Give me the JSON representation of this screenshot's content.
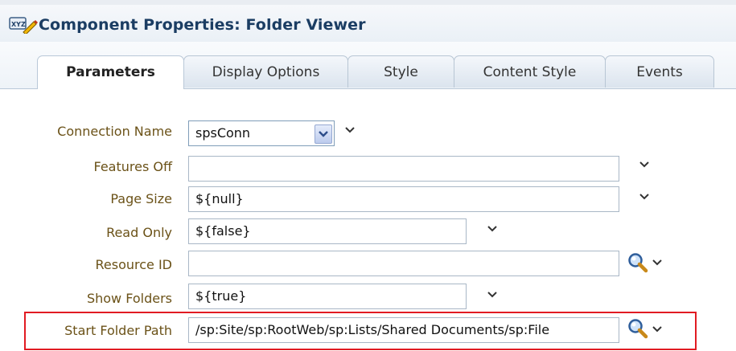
{
  "header": {
    "title": "Component Properties: Folder Viewer",
    "icon": "properties-xyz-icon"
  },
  "tabs": [
    {
      "label": "Parameters",
      "active": true
    },
    {
      "label": "Display Options",
      "active": false
    },
    {
      "label": "Style",
      "active": false
    },
    {
      "label": "Content Style",
      "active": false
    },
    {
      "label": "Events",
      "active": false
    }
  ],
  "fields": {
    "connection_name": {
      "label": "Connection Name",
      "value": "spsConn"
    },
    "features_off": {
      "label": "Features Off",
      "value": ""
    },
    "page_size": {
      "label": "Page Size",
      "value": "${null}"
    },
    "read_only": {
      "label": "Read Only",
      "value": "${false}"
    },
    "resource_id": {
      "label": "Resource ID",
      "value": ""
    },
    "show_folders": {
      "label": "Show Folders",
      "value": "${true}"
    },
    "start_folder_path": {
      "label": "Start Folder Path",
      "value": "/sp:Site/sp:RootWeb/sp:Lists/Shared Documents/sp:File"
    }
  },
  "colors": {
    "title": "#1b3d63",
    "label": "#6b5218",
    "highlight": "#e11b22"
  },
  "icons": {
    "dropdown": "chevron-down-icon",
    "search": "magnifier-icon"
  }
}
